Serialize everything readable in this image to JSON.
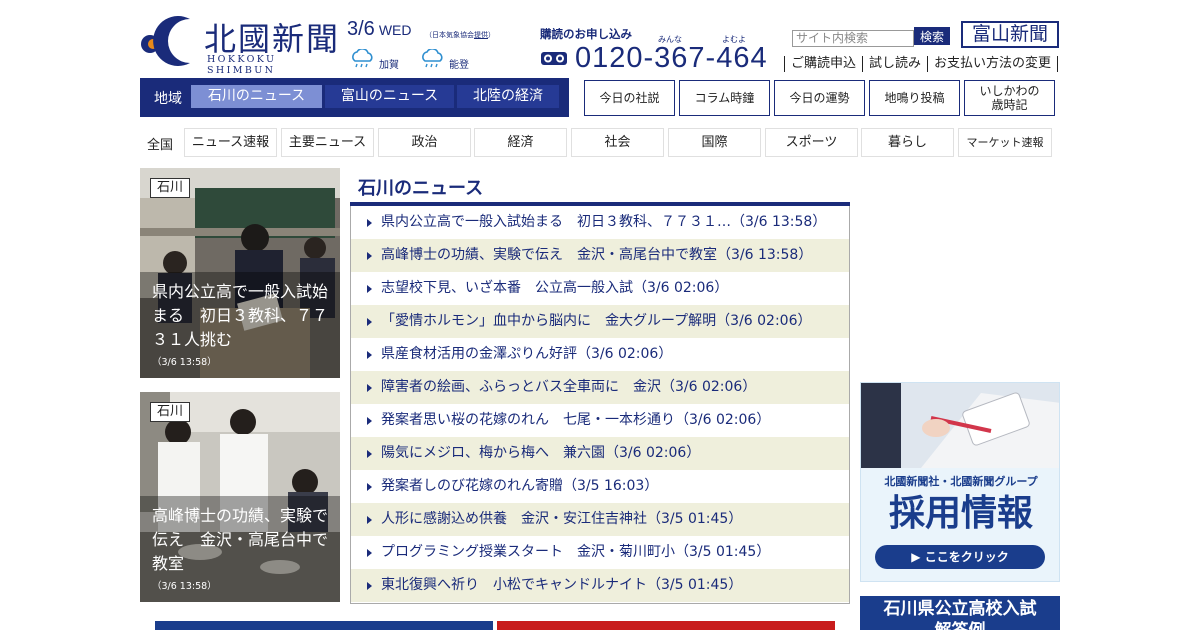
{
  "header": {
    "logo_jp": "北國新聞",
    "logo_en": "HOKKOKU SHIMBUN",
    "date": "3/6",
    "weekday": "WED",
    "weather_source": "（日本気象協会",
    "weather_source_link": "提供",
    "weather_source_end": "）",
    "weather": [
      {
        "area": "加賀",
        "icon": "cloud-rain-icon"
      },
      {
        "area": "能登",
        "icon": "cloud-rain-icon"
      }
    ],
    "subscribe_title": "購読のお申し込み",
    "subscribe_ruby_1": "みんな",
    "subscribe_ruby_2": "よむよ",
    "phone": "0120-367-464",
    "search_placeholder": "サイト内検索",
    "search_button": "検索",
    "toyama_link": "富山新聞",
    "top_links": [
      "ご購読申込",
      "試し読み",
      "お支払い方法の変更"
    ]
  },
  "region_nav": {
    "label": "地域",
    "tabs": [
      "石川のニュース",
      "富山のニュース",
      "北陸の経済"
    ]
  },
  "box_links": [
    "今日の社説",
    "コラム時鐘",
    "今日の運勢",
    "地鳴り投稿",
    "いしかわの\n歳時記"
  ],
  "category_nav": {
    "label": "全国",
    "items": [
      "ニュース速報",
      "主要ニュース",
      "政治",
      "経済",
      "社会",
      "国際",
      "スポーツ",
      "暮らし",
      "マーケット速報"
    ]
  },
  "features": [
    {
      "tag": "石川",
      "title": "県内公立高で一般入試始まる　初日３教科、７７３１人挑む",
      "time": "（3/6 13:58）"
    },
    {
      "tag": "石川",
      "title": "高峰博士の功績、実験で伝え　金沢・高尾台中で教室",
      "time": "（3/6 13:58）"
    }
  ],
  "news": {
    "heading": "石川のニュース",
    "items": [
      "県内公立高で一般入試始まる　初日３教科、７７３１…（3/6 13:58）",
      "高峰博士の功績、実験で伝え　金沢・高尾台中で教室（3/6 13:58）",
      "志望校下見、いざ本番　公立高一般入試（3/6 02:06）",
      "「愛情ホルモン」血中から脳内に　金大グループ解明（3/6 02:06）",
      "県産食材活用の金澤ぷりん好評（3/6 02:06）",
      "障害者の絵画、ふらっとバス全車両に　金沢（3/6 02:06）",
      "発案者思い桜の花嫁のれん　七尾・一本杉通り（3/6 02:06）",
      "陽気にメジロ、梅から梅へ　兼六園（3/6 02:06）",
      "発案者しのび花嫁のれん寄贈（3/5 16:03）",
      "人形に感謝込め供養　金沢・安江住吉神社（3/5 01:45）",
      "プログラミング授業スタート　金沢・菊川町小（3/5 01:45）",
      "東北復興へ祈り　小松でキャンドルナイト（3/5 01:45）"
    ]
  },
  "banners": {
    "recruit_line1": "北國新聞社・北國新聞グループ",
    "recruit_line2": "採用情報",
    "recruit_button": "▶ ここをクリック",
    "exam_line1": "石川県公立高校入試",
    "exam_line2": "解答例"
  },
  "colors": {
    "brand": "#1a2b7a",
    "tab_active": "#7d8fd4",
    "row_alt": "#efefdc"
  }
}
